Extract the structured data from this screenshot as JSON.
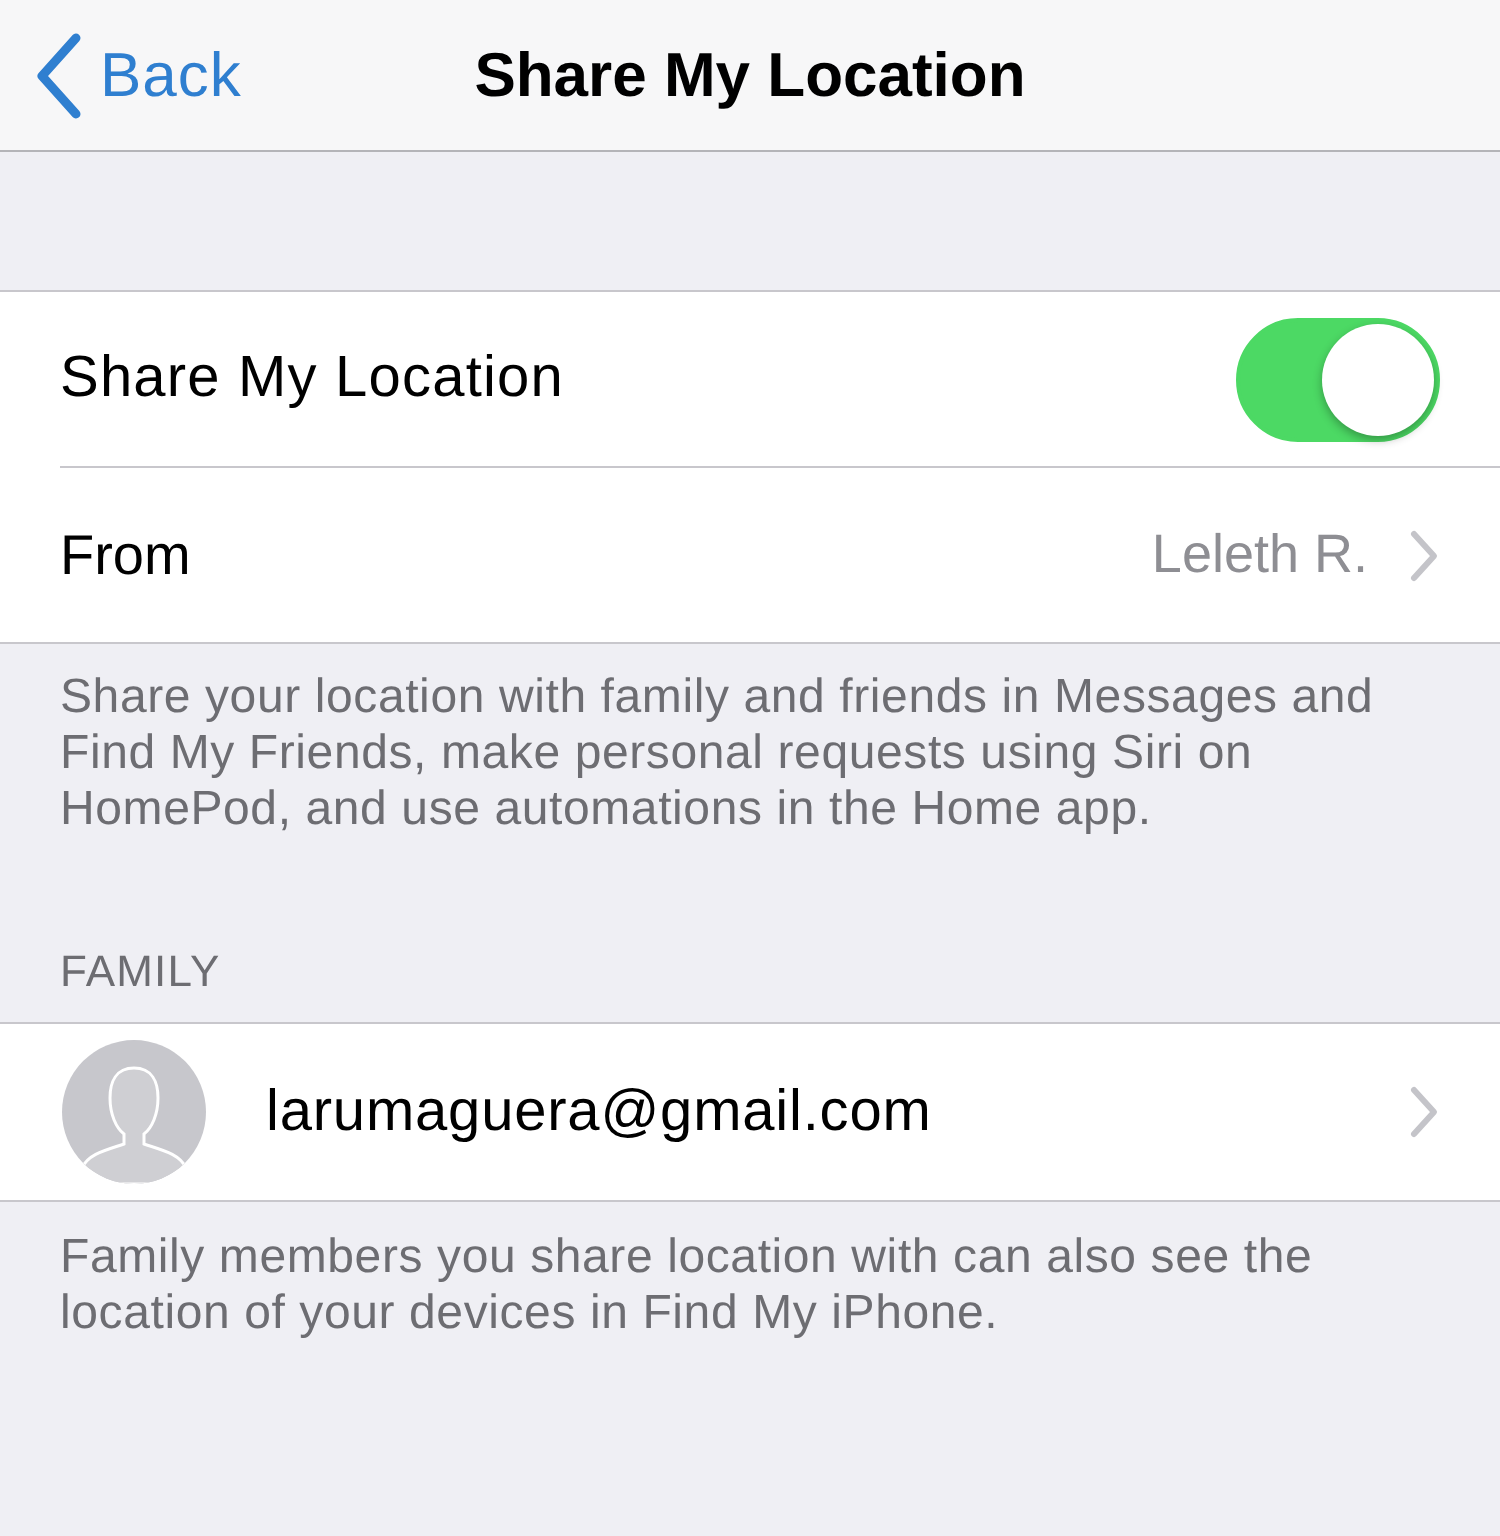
{
  "nav_bar": {
    "back_label": "Back",
    "title": "Share My Location"
  },
  "settings_group": {
    "rows": [
      {
        "kind": "toggle",
        "label": "Share My Location",
        "on": true
      },
      {
        "kind": "disclosure",
        "label": "From",
        "value": "Leleth R."
      }
    ],
    "footer": "Share your location with family and friends in Messages and Find My Friends, make personal requests using Siri on HomePod, and use automations in the Home app."
  },
  "family": {
    "header": "FAMILY",
    "members": [
      {
        "email": "larumaguera@gmail.com"
      }
    ],
    "footer": "Family members you share location with can also see the location of your devices in Find My iPhone."
  }
}
